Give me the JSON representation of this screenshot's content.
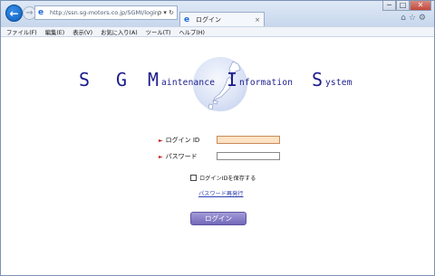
{
  "browser": {
    "address_url": "http://ssn.sg-motors.co.jp/SGMI/login",
    "address_icons": "ρ ▾ ↻",
    "tab_title": "ログイン",
    "tab_close": "×",
    "window_buttons": {
      "minimize": "─",
      "maximize": "□",
      "close": "✕"
    },
    "right_icons": "⌂☆⚙",
    "back": "←",
    "forward": "→",
    "address_icon": "e",
    "tab_icon": "e"
  },
  "menubar": {
    "items": [
      "ファイル(F)",
      "編集(E)",
      "表示(V)",
      "お気に入り(A)",
      "ツール(T)",
      "ヘルプ(H)"
    ]
  },
  "logo": {
    "s1": "S",
    "g": "G",
    "m": "M",
    "aintenance": "aintenance",
    "i": "I",
    "nformation": "nformation",
    "s2": "S",
    "ystem": "ystem"
  },
  "form": {
    "arrow": "►",
    "login_id_label": "ログイン ID",
    "password_label": "パスワード",
    "login_id_value": "",
    "password_value": "",
    "remember_label": "ログインIDを保存する",
    "reset_link": "パスワード再発行",
    "submit_label": "ログイン"
  },
  "colors": {
    "logo_text": "#1c1c8c",
    "active_field": "#fde2c4",
    "button": "#7168b8",
    "arrow": "#d21919"
  }
}
